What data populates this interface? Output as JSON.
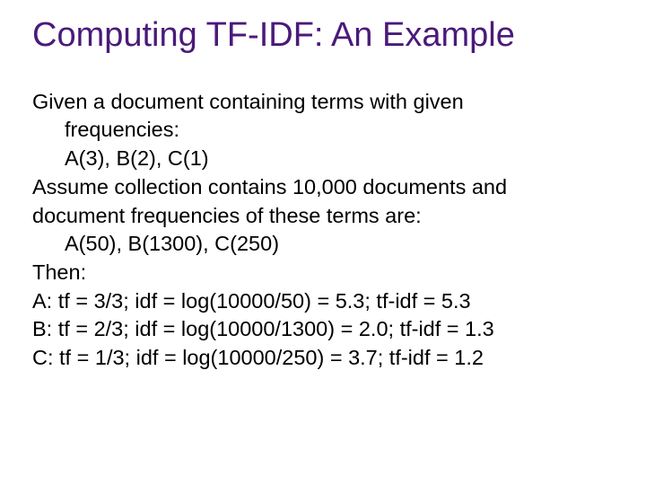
{
  "title": "Computing TF-IDF: An Example",
  "lines": {
    "l1": "Given a document containing terms with given",
    "l2": "frequencies:",
    "l3": "A(3), B(2), C(1)",
    "l4": "Assume collection contains 10,000 documents and",
    "l5": "document frequencies of these terms are:",
    "l6": "A(50), B(1300), C(250)",
    "l7": "Then:",
    "l8": "A:  tf = 3/3;  idf = log(10000/50) = 5.3;    tf-idf = 5.3",
    "l9": "B:  tf = 2/3;  idf = log(10000/1300) = 2.0; tf-idf = 1.3",
    "l10": "C:  tf = 1/3;  idf = log(10000/250) = 3.7;   tf-idf = 1.2"
  }
}
